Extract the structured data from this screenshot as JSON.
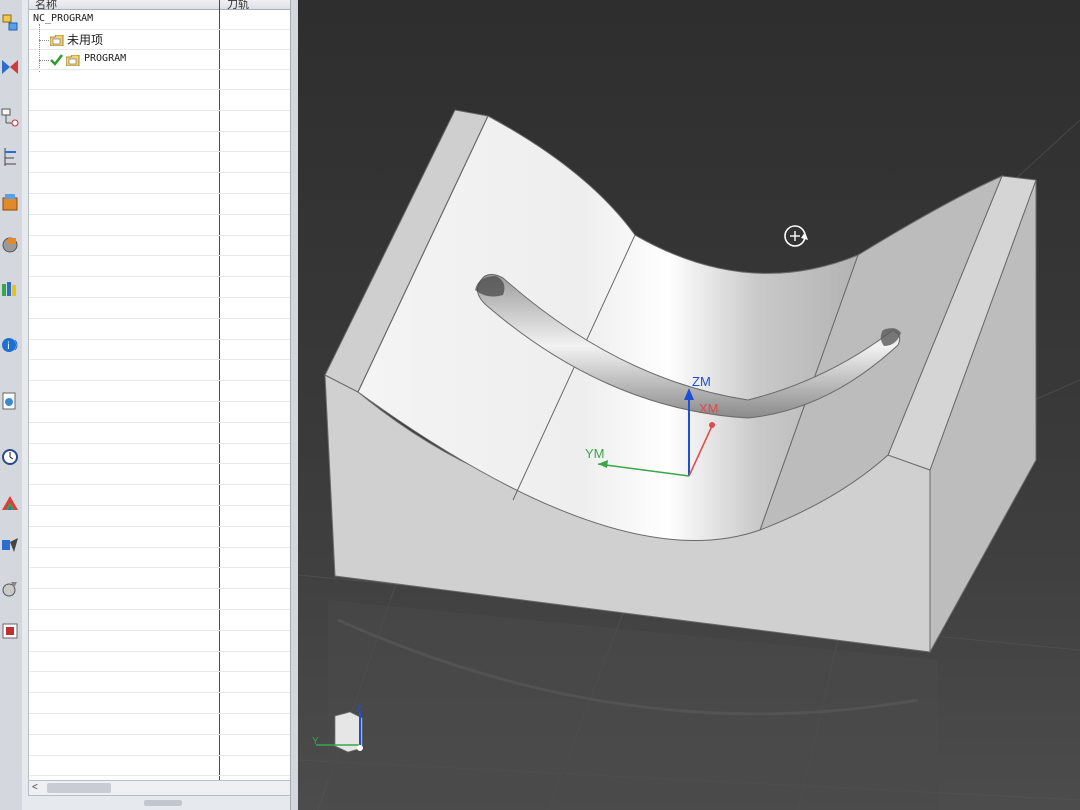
{
  "navigator": {
    "columns": {
      "name": "名称",
      "tool": "刀轨"
    },
    "rows": [
      {
        "label": "NC_PROGRAM",
        "level": 0,
        "icon": "",
        "checked": false
      },
      {
        "label": "未用项",
        "level": 1,
        "icon": "folder-icon",
        "checked": false
      },
      {
        "label": "PROGRAM",
        "level": 1,
        "icon": "folder-icon",
        "checked": true
      }
    ],
    "scroll_left": "<",
    "scroll_right": ">"
  },
  "resource_bar": {
    "icons": [
      "assembly-navigator-icon",
      "constraint-navigator-icon",
      "part-navigator-icon",
      "operation-navigator-icon",
      "machine-tool-icon",
      "reuse-library-icon",
      "roles-icon",
      "web-browser-icon",
      "history-icon",
      "system-materials-icon",
      "process-studio-icon",
      "manufacturing-wizard-icon",
      "ug-icon"
    ]
  },
  "viewport": {
    "wcs": {
      "z_label": "ZM",
      "x_label": "XM",
      "y_label": "YM"
    },
    "triad": {
      "z_label": "Z",
      "y_label": "Y"
    },
    "colors": {
      "background_top": "#2f2f2f",
      "background_bottom": "#4a4a4a",
      "part_face": "#d8d8d8",
      "z_axis": "#1f4fd1",
      "x_axis": "#e04a4a",
      "y_axis": "#3aa64a"
    }
  }
}
